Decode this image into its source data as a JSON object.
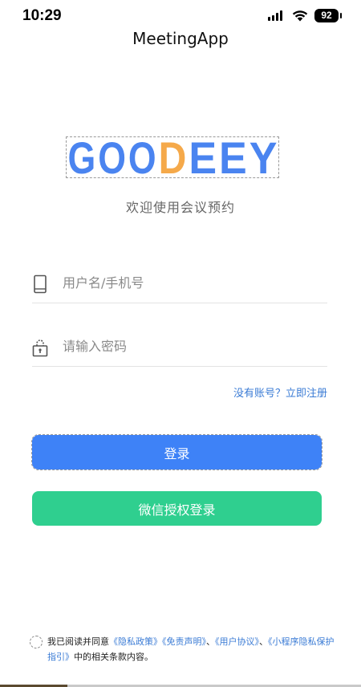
{
  "status_bar": {
    "time": "10:29",
    "battery": "92"
  },
  "nav": {
    "title": "MeetingApp"
  },
  "logo": {
    "text": "GOODEEY",
    "letters": [
      "G",
      "O",
      "O",
      "D",
      "E",
      "E",
      "Y"
    ],
    "primary_color": "#4a84f0",
    "accent_color": "#f5a94a",
    "accent_letter_index": 3
  },
  "welcome": "欢迎使用会议预约",
  "form": {
    "username_placeholder": "用户名/手机号",
    "password_placeholder": "请输入密码",
    "register_link": "没有账号？立即注册"
  },
  "buttons": {
    "login": "登录",
    "wechat_login": "微信授权登录"
  },
  "agreement": {
    "prefix": "我已阅读并同意",
    "privacy_policy": "《隐私政策》",
    "disclaimer": "《免责声明》",
    "sep1": "、",
    "user_agreement": "《用户协议》",
    "sep2": "、",
    "mini_program_guide": "《小程序隐私保护指引》",
    "suffix": "中的相关条款内容。"
  },
  "colors": {
    "login_button": "#3e82f7",
    "wechat_button": "#2fcf8f",
    "link": "#3a7bd5"
  },
  "icons": {
    "username": "phone-icon",
    "password": "lock-icon"
  }
}
